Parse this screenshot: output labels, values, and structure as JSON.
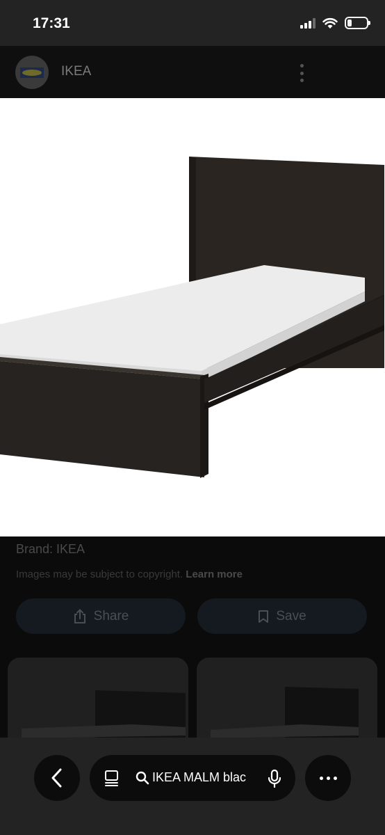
{
  "status_bar": {
    "time": "17:31"
  },
  "header": {
    "site_name": "IKEA"
  },
  "info": {
    "brand": "Brand: IKEA",
    "copyright_text": "Images may be subject to copyright.",
    "learn_more": "Learn more"
  },
  "actions": {
    "share_label": "Share",
    "save_label": "Save"
  },
  "search": {
    "query": "IKEA MALM blac"
  },
  "colors": {
    "bed_frame": "#26221f",
    "mattress": "#ececec",
    "background": "#0b0b0b"
  },
  "icons": [
    "signal-icon",
    "wifi-icon",
    "battery-icon",
    "ikea-logo",
    "more-vert-icon",
    "share-icon",
    "bookmark-icon",
    "back-icon",
    "tabs-icon",
    "search-icon",
    "mic-icon",
    "more-horiz-icon"
  ]
}
